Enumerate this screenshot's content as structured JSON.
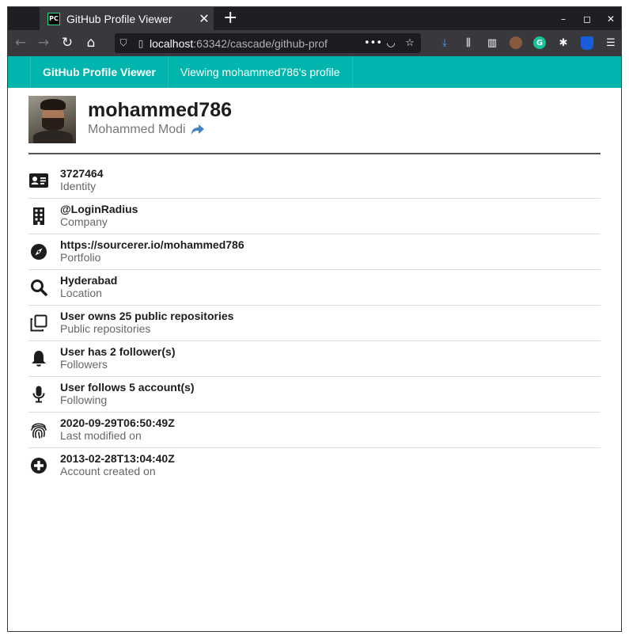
{
  "browser": {
    "tab_title": "GitHub Profile Viewer",
    "tab_favicon_text": "PC",
    "tab_close": "✕",
    "new_tab": "+",
    "url_host": "localhost",
    "url_rest": ":63342/cascade/github-prof",
    "window_minimize": "–",
    "window_maximize": "◻",
    "window_close": "✕"
  },
  "header": {
    "brand": "GitHub Profile Viewer",
    "viewing": "Viewing mohammed786's profile",
    "accent_color": "#00b5ad"
  },
  "profile": {
    "username": "mohammed786",
    "full_name": "Mohammed Modi",
    "share_icon": "share-icon",
    "link_color": "#4183c4"
  },
  "details": [
    {
      "icon": "id-card-icon",
      "value": "3727464",
      "label": "Identity"
    },
    {
      "icon": "building-icon",
      "value": "@LoginRadius",
      "label": "Company"
    },
    {
      "icon": "compass-icon",
      "value": "https://sourcerer.io/mohammed786",
      "label": "Portfolio"
    },
    {
      "icon": "search-icon",
      "value": "Hyderabad",
      "label": "Location"
    },
    {
      "icon": "copy-icon",
      "value": "User owns 25 public repositories",
      "label": "Public repositories"
    },
    {
      "icon": "bell-icon",
      "value": "User has 2 follower(s)",
      "label": "Followers"
    },
    {
      "icon": "microphone-icon",
      "value": "User follows 5 account(s)",
      "label": "Following"
    },
    {
      "icon": "fingerprint-icon",
      "value": "2020-09-29T06:50:49Z",
      "label": "Last modified on"
    },
    {
      "icon": "plus-circle-icon",
      "value": "2013-02-28T13:04:40Z",
      "label": "Account created on"
    }
  ]
}
